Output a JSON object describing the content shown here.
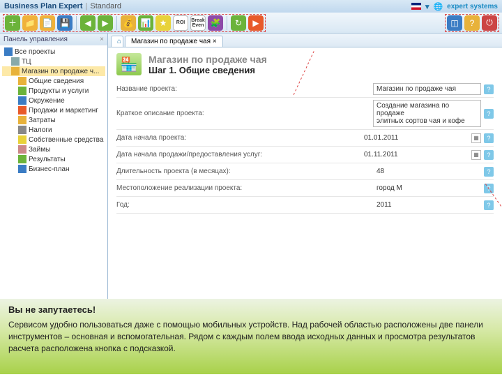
{
  "titlebar": {
    "app": "Business Plan Expert",
    "edition": "Standard",
    "brand": "expert systems"
  },
  "toolbar": {
    "left": [
      {
        "name": "new",
        "color": "#6bb33a",
        "glyph": "＋"
      },
      {
        "name": "open",
        "color": "#f0b23a",
        "glyph": "📁"
      },
      {
        "name": "recent",
        "color": "#f0b23a",
        "glyph": "📄"
      },
      {
        "name": "save",
        "color": "#3a7cc4",
        "glyph": "💾"
      },
      {
        "name": "sep",
        "sep": true
      },
      {
        "name": "back",
        "color": "#6bb33a",
        "glyph": "◀"
      },
      {
        "name": "fwd",
        "color": "#6bb33a",
        "glyph": "▶"
      },
      {
        "name": "sep2",
        "sep": true
      },
      {
        "name": "money",
        "color": "#e8b23a",
        "glyph": "💰"
      },
      {
        "name": "chart",
        "color": "#6bb33a",
        "glyph": "📊"
      },
      {
        "name": "star",
        "color": "#e8d23a",
        "glyph": "★"
      },
      {
        "name": "roi",
        "color": "#fff",
        "glyph": "ROI"
      },
      {
        "name": "breakeven",
        "color": "#fff",
        "glyph": "Break\nEven"
      },
      {
        "name": "puzzle",
        "color": "#8e4aa8",
        "glyph": "🧩"
      },
      {
        "name": "sep3",
        "sep": true
      },
      {
        "name": "refresh",
        "color": "#6bb33a",
        "glyph": "↻"
      },
      {
        "name": "play",
        "color": "#e85a2a",
        "glyph": "▶"
      }
    ],
    "right": [
      {
        "name": "window",
        "color": "#3a7cc4",
        "glyph": "◫"
      },
      {
        "name": "help",
        "color": "#e8b23a",
        "glyph": "?"
      },
      {
        "name": "exit",
        "color": "#c44",
        "glyph": "⏻"
      }
    ]
  },
  "sidebar": {
    "title": "Панель управления",
    "items": [
      {
        "indent": 0,
        "label": "Все проекты",
        "icon": "#3a7cc4"
      },
      {
        "indent": 1,
        "label": "ТЦ",
        "icon": "#8aa"
      },
      {
        "indent": 1,
        "label": "Магазин по продаже ч...",
        "icon": "#e8b23a",
        "sel": true
      },
      {
        "indent": 2,
        "label": "Общие сведения",
        "icon": "#e8b23a"
      },
      {
        "indent": 2,
        "label": "Продукты и услуги",
        "icon": "#6bb33a"
      },
      {
        "indent": 2,
        "label": "Окружение",
        "icon": "#3a7cc4"
      },
      {
        "indent": 2,
        "label": "Продажи и маркетинг",
        "icon": "#e85a2a"
      },
      {
        "indent": 2,
        "label": "Затраты",
        "icon": "#e8b23a"
      },
      {
        "indent": 2,
        "label": "Налоги",
        "icon": "#888"
      },
      {
        "indent": 2,
        "label": "Собственные средства",
        "icon": "#e8d23a"
      },
      {
        "indent": 2,
        "label": "Займы",
        "icon": "#c88"
      },
      {
        "indent": 2,
        "label": "Результаты",
        "icon": "#6bb33a"
      },
      {
        "indent": 2,
        "label": "Бизнес-план",
        "icon": "#3a7cc4"
      }
    ]
  },
  "tabs": {
    "home": "⌂",
    "active": "Магазин по продаже чая ×"
  },
  "page": {
    "title": "Магазин по продаже чая",
    "step": "Шаг 1. Общие сведения"
  },
  "fields": [
    {
      "label": "Название проекта:",
      "value": "Магазин по продаже чая",
      "boxed": true,
      "help": true
    },
    {
      "label": "Краткое описание проекта:",
      "value": "Создание магазина по продаже\nэлитных сортов чая и кофе",
      "boxed": true,
      "help": true
    },
    {
      "label": "Дата начала проекта:",
      "value": "01.01.2011",
      "cal": true,
      "help": true
    },
    {
      "label": "Дата начала продажи/предоставления услуг:",
      "value": "01.11.2011",
      "cal": true,
      "help": true
    },
    {
      "label": "Длительность проекта (в месяцах):",
      "value": "48",
      "help": true
    },
    {
      "label": "Местоположение реализации проекта:",
      "value": "город М",
      "help": true
    },
    {
      "label": "Год:",
      "value": "2011",
      "help": true
    }
  ],
  "footer": {
    "title": "Вы не запутаетесь!",
    "text": "Сервисом удобно пользоваться даже с помощью мобильных устройств. Над рабочей областью расположены две панели инструментов – основная и вспомогательная. Рядом с каждым полем ввода исходных данных и просмотра результатов расчета расположена кнопка с подсказкой."
  }
}
